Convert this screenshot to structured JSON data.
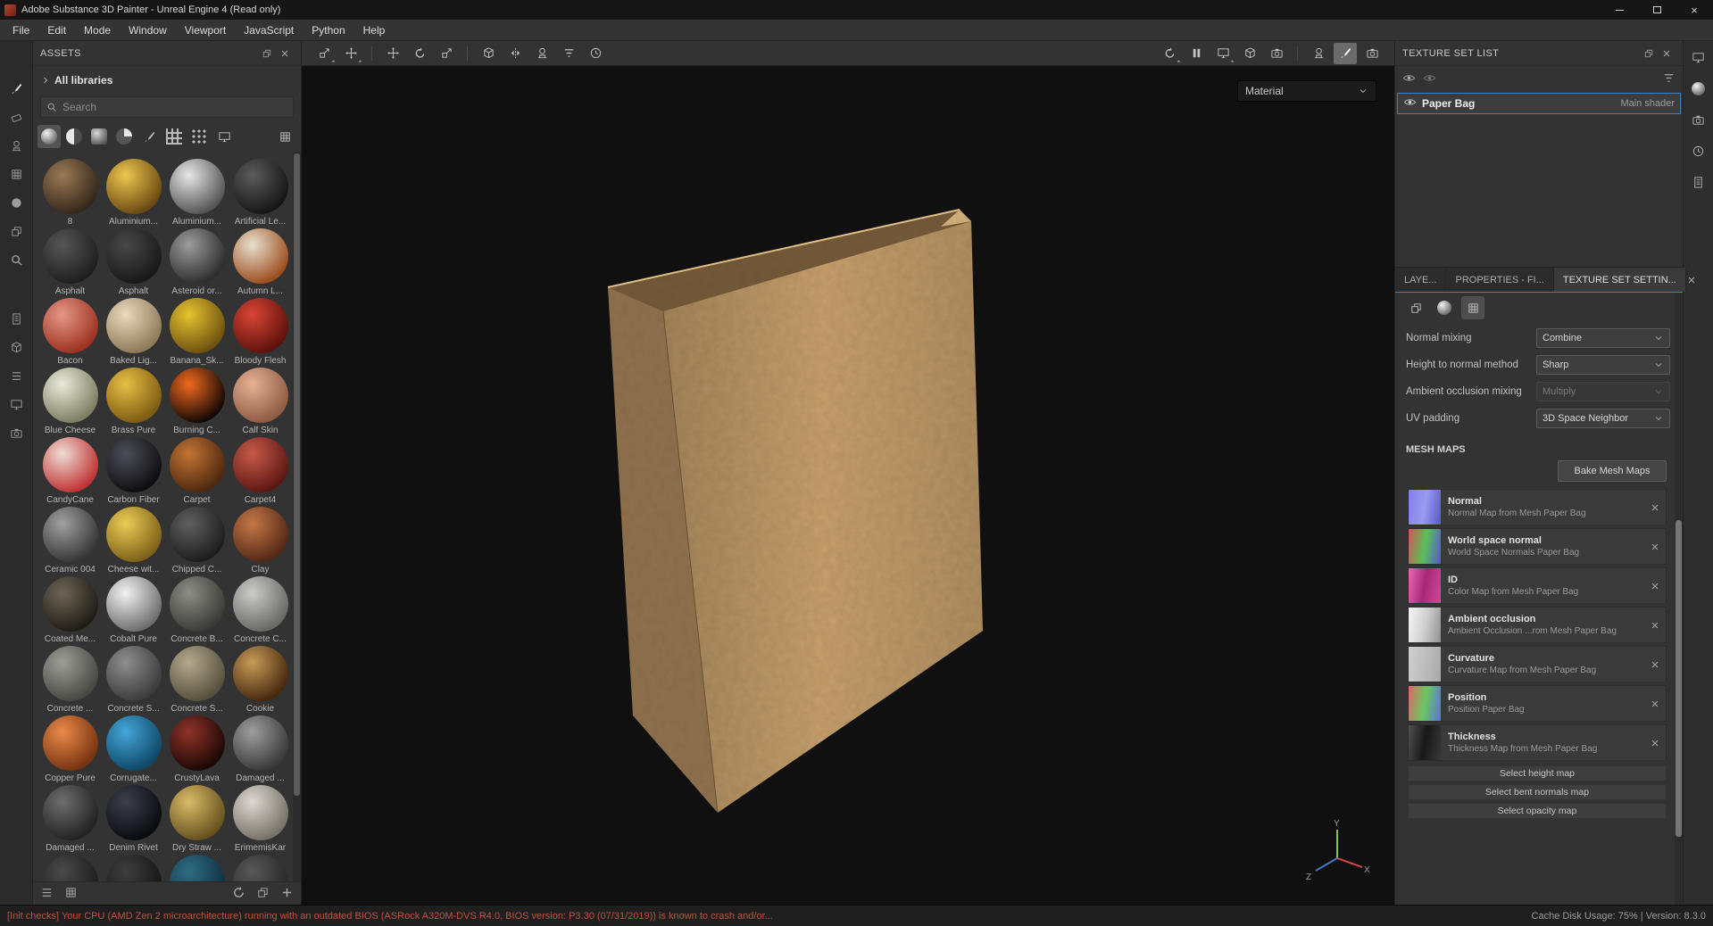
{
  "titlebar": {
    "title": "Adobe Substance 3D Painter - Unreal Engine 4 (Read only)"
  },
  "menubar": {
    "items": [
      "File",
      "Edit",
      "Mode",
      "Window",
      "Viewport",
      "JavaScript",
      "Python",
      "Help"
    ]
  },
  "assets_panel": {
    "title": "ASSETS",
    "libraries_label": "All libraries",
    "search_placeholder": "Search",
    "assets": [
      {
        "name": "8",
        "colors": [
          "#9a7a56",
          "#35281a"
        ]
      },
      {
        "name": "Aluminium...",
        "colors": [
          "#eec74e",
          "#6b4a12"
        ]
      },
      {
        "name": "Aluminium...",
        "colors": [
          "#e6e6e6",
          "#555555"
        ]
      },
      {
        "name": "Artificial Le...",
        "colors": [
          "#5c5c5c",
          "#161616"
        ]
      },
      {
        "name": "Asphalt",
        "colors": [
          "#565656",
          "#1f1f1f"
        ]
      },
      {
        "name": "Asphalt",
        "colors": [
          "#484848",
          "#191919"
        ]
      },
      {
        "name": "Asteroid or...",
        "colors": [
          "#9c9c9c",
          "#2e2e2e"
        ]
      },
      {
        "name": "Autumn L...",
        "colors": [
          "#e7e0cf",
          "#9c4e1e"
        ]
      },
      {
        "name": "Bacon",
        "colors": [
          "#e59786",
          "#9c3222"
        ]
      },
      {
        "name": "Baked Lig...",
        "colors": [
          "#ead9bd",
          "#8d7a58"
        ]
      },
      {
        "name": "Banana_Sk...",
        "colors": [
          "#e5c32f",
          "#6e5210"
        ]
      },
      {
        "name": "Bloody Flesh",
        "colors": [
          "#d94536",
          "#5f120c"
        ]
      },
      {
        "name": "Blue Cheese",
        "colors": [
          "#e9e9da",
          "#7e7e62"
        ]
      },
      {
        "name": "Brass Pure",
        "colors": [
          "#e7bf45",
          "#7e5c12"
        ]
      },
      {
        "name": "Burning C...",
        "colors": [
          "#f06a1e",
          "#140804"
        ]
      },
      {
        "name": "Calf Skin",
        "colors": [
          "#e6b193",
          "#8e5b43"
        ]
      },
      {
        "name": "CandyCane",
        "colors": [
          "#efdcd4",
          "#bf3333"
        ]
      },
      {
        "name": "Carbon Fiber",
        "colors": [
          "#4e4e58",
          "#0e0e12"
        ]
      },
      {
        "name": "Carpet",
        "colors": [
          "#c27434",
          "#4f280e"
        ]
      },
      {
        "name": "Carpet4",
        "colors": [
          "#c65a49",
          "#5e1813"
        ]
      },
      {
        "name": "Ceramic 004",
        "colors": [
          "#a0a0a0",
          "#383838"
        ]
      },
      {
        "name": "Cheese wit...",
        "colors": [
          "#e9cd55",
          "#7e6118"
        ]
      },
      {
        "name": "Chipped C...",
        "colors": [
          "#606060",
          "#1d1d1d"
        ]
      },
      {
        "name": "Clay",
        "colors": [
          "#c57747",
          "#542816"
        ]
      },
      {
        "name": "Coated Me...",
        "colors": [
          "#6e6656",
          "#201c16"
        ]
      },
      {
        "name": "Cobalt Pure",
        "colors": [
          "#f2f2f2",
          "#6e6e6e"
        ]
      },
      {
        "name": "Concrete B...",
        "colors": [
          "#8e8e88",
          "#3a3a36"
        ]
      },
      {
        "name": "Concrete C...",
        "colors": [
          "#cbcbc7",
          "#686864"
        ]
      },
      {
        "name": "Concrete ...",
        "colors": [
          "#9e9e98",
          "#484842"
        ]
      },
      {
        "name": "Concrete S...",
        "colors": [
          "#8e8e8e",
          "#3c3c3c"
        ]
      },
      {
        "name": "Concrete S...",
        "colors": [
          "#b5a98f",
          "#57503c"
        ]
      },
      {
        "name": "Cookie",
        "colors": [
          "#c79a57",
          "#47290e"
        ]
      },
      {
        "name": "Copper Pure",
        "colors": [
          "#ea8a4c",
          "#77330f"
        ]
      },
      {
        "name": "Corrugate...",
        "colors": [
          "#45a6d8",
          "#0e4868"
        ]
      },
      {
        "name": "CrustyLava",
        "colors": [
          "#8e3329",
          "#1d0806"
        ]
      },
      {
        "name": "Damaged ...",
        "colors": [
          "#9e9e9e",
          "#3a3a3a"
        ]
      },
      {
        "name": "Damaged ...",
        "colors": [
          "#6e6e6e",
          "#222222"
        ]
      },
      {
        "name": "Denim Rivet",
        "colors": [
          "#3c404c",
          "#090b0f"
        ]
      },
      {
        "name": "Dry Straw ...",
        "colors": [
          "#d9ba67",
          "#66511e"
        ]
      },
      {
        "name": "ErimemisKar",
        "colors": [
          "#dcd8d0",
          "#767268"
        ]
      },
      {
        "name": "",
        "colors": [
          "#4a4a4a",
          "#1c1c1c"
        ]
      },
      {
        "name": "",
        "colors": [
          "#3e3e3e",
          "#151515"
        ]
      },
      {
        "name": "",
        "colors": [
          "#2e6e86",
          "#0e2e3e"
        ]
      },
      {
        "name": "",
        "colors": [
          "#585858",
          "#262626"
        ]
      }
    ]
  },
  "viewport": {
    "shading_mode": "Material",
    "bag": {
      "front": "#c7a06c",
      "side": "#b08a5e",
      "inside": "#6e5535",
      "rim": "#d9b580"
    },
    "gizmo": {
      "x_color": "#d04545",
      "y_color": "#7ec845",
      "z_color": "#4575d0",
      "x_label": "X",
      "y_label": "Y",
      "z_label": "Z"
    }
  },
  "texture_set_list": {
    "title": "TEXTURE SET LIST",
    "set_name": "Paper Bag",
    "shader_label": "Main shader"
  },
  "settings_panel": {
    "tabs": [
      "LAYE...",
      "PROPERTIES - FI...",
      "TEXTURE SET SETTIN..."
    ],
    "active_tab": 2,
    "fields": [
      {
        "label": "Normal mixing",
        "value": "Combine",
        "enabled": true
      },
      {
        "label": "Height to normal method",
        "value": "Sharp",
        "enabled": true
      },
      {
        "label": "Ambient occlusion mixing",
        "value": "Multiply",
        "enabled": false
      },
      {
        "label": "UV padding",
        "value": "3D Space Neighbor",
        "enabled": true
      }
    ],
    "mesh_maps_title": "MESH MAPS",
    "bake_button": "Bake Mesh Maps",
    "mesh_maps": [
      {
        "name": "Normal",
        "desc": "Normal Map from Mesh Paper Bag",
        "colors": [
          "#8080e8",
          "#9a9af0",
          "#5858c8"
        ]
      },
      {
        "name": "World space normal",
        "desc": "World Space Normals Paper Bag",
        "colors": [
          "#d05858",
          "#58c058",
          "#5858d0"
        ]
      },
      {
        "name": "ID",
        "desc": "Color Map from Mesh Paper Bag",
        "colors": [
          "#e868b8",
          "#a82878",
          "#d04898"
        ]
      },
      {
        "name": "Ambient occlusion",
        "desc": "Ambient Occlusion ...rom Mesh Paper Bag",
        "colors": [
          "#f5f5f5",
          "#d0d0d0",
          "#909090"
        ]
      },
      {
        "name": "Curvature",
        "desc": "Curvature Map from Mesh Paper Bag",
        "colors": [
          "#cfcfcf",
          "#bdbdbd",
          "#a9a9a9"
        ]
      },
      {
        "name": "Position",
        "desc": "Position Paper Bag",
        "colors": [
          "#e06868",
          "#68c860",
          "#6070e0"
        ]
      },
      {
        "name": "Thickness",
        "desc": "Thickness Map from Mesh Paper Bag",
        "colors": [
          "#505050",
          "#181818",
          "#383838"
        ]
      }
    ],
    "select_buttons": [
      "Select height map",
      "Select bent normals map",
      "Select opacity map"
    ]
  },
  "statusbar": {
    "warning": "[Init checks] Your CPU (AMD Zen 2 microarchitecture) running with an outdated BIOS (ASRock A320M-DVS R4.0, BIOS version: P3.30 (07/31/2019)) is known to crash and/or...",
    "right_text": "Cache Disk Usage:  75% | Version: 8.3.0"
  }
}
